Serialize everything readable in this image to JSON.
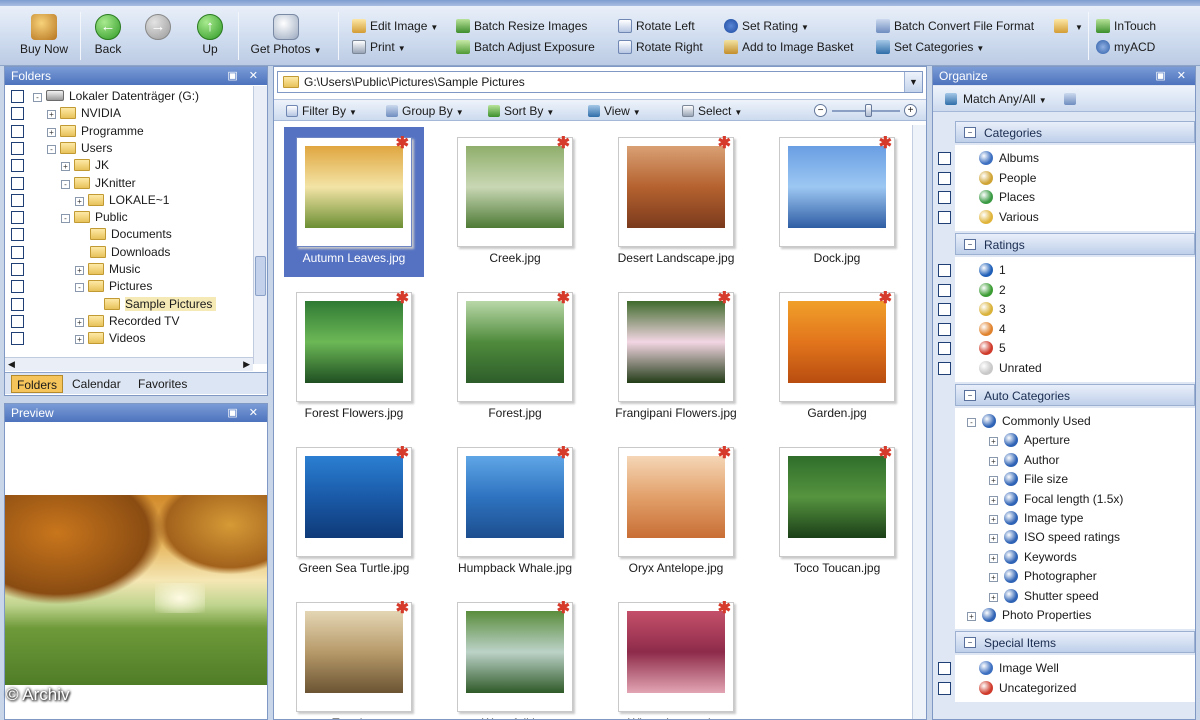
{
  "toolbar": {
    "buy_now": "Buy Now",
    "back": "Back",
    "up": "Up",
    "get_photos": "Get Photos",
    "edit_image": "Edit Image",
    "print": "Print",
    "batch_resize": "Batch Resize Images",
    "batch_exposure": "Batch Adjust Exposure",
    "rotate_left": "Rotate Left",
    "rotate_right": "Rotate Right",
    "set_rating": "Set Rating",
    "add_basket": "Add to Image Basket",
    "batch_convert": "Batch Convert File Format",
    "set_categories": "Set Categories",
    "intouch": "InTouch",
    "myacd": "myACD"
  },
  "folders": {
    "title": "Folders",
    "tree": [
      {
        "label": "Lokaler Datenträger (G:)",
        "depth": 0,
        "type": "drive",
        "expander": "-"
      },
      {
        "label": "NVIDIA",
        "depth": 1,
        "type": "folder",
        "expander": "+"
      },
      {
        "label": "Programme",
        "depth": 1,
        "type": "folder",
        "expander": "+"
      },
      {
        "label": "Users",
        "depth": 1,
        "type": "folder",
        "expander": "-"
      },
      {
        "label": "JK",
        "depth": 2,
        "type": "folder",
        "expander": "+"
      },
      {
        "label": "JKnitter",
        "depth": 2,
        "type": "folder",
        "expander": "-"
      },
      {
        "label": "LOKALE~1",
        "depth": 3,
        "type": "folder",
        "expander": "+"
      },
      {
        "label": "Public",
        "depth": 2,
        "type": "folder",
        "expander": "-"
      },
      {
        "label": "Documents",
        "depth": 3,
        "type": "folder",
        "expander": ""
      },
      {
        "label": "Downloads",
        "depth": 3,
        "type": "folder",
        "expander": ""
      },
      {
        "label": "Music",
        "depth": 3,
        "type": "folder",
        "expander": "+"
      },
      {
        "label": "Pictures",
        "depth": 3,
        "type": "folder",
        "expander": "-"
      },
      {
        "label": "Sample Pictures",
        "depth": 4,
        "type": "folder",
        "expander": "",
        "selected": true
      },
      {
        "label": "Recorded TV",
        "depth": 3,
        "type": "folder",
        "expander": "+"
      },
      {
        "label": "Videos",
        "depth": 3,
        "type": "folder",
        "expander": "+"
      }
    ],
    "tabs": [
      "Folders",
      "Calendar",
      "Favorites"
    ]
  },
  "preview": {
    "title": "Preview"
  },
  "watermark": "© Archiv",
  "browser": {
    "path": "G:\\Users\\Public\\Pictures\\Sample Pictures",
    "viewbar": {
      "filter_by": "Filter By",
      "group_by": "Group By",
      "sort_by": "Sort By",
      "view": "View",
      "select": "Select"
    },
    "zoom_level": 0.55,
    "files": [
      {
        "name": "Autumn Leaves.jpg",
        "selected": true,
        "colors": [
          "#e0a640",
          "#f3e4a6",
          "#6c8f33"
        ]
      },
      {
        "name": "Creek.jpg",
        "colors": [
          "#8fae6b",
          "#c9d7b4",
          "#4d7a35"
        ]
      },
      {
        "name": "Desert Landscape.jpg",
        "colors": [
          "#d9a074",
          "#b5622f",
          "#7b3a1d"
        ]
      },
      {
        "name": "Dock.jpg",
        "colors": [
          "#6a9ee3",
          "#9cc7f3",
          "#2f5da3"
        ]
      },
      {
        "name": "Forest Flowers.jpg",
        "colors": [
          "#2f7a34",
          "#6cb856",
          "#1f4f22"
        ]
      },
      {
        "name": "Forest.jpg",
        "colors": [
          "#b9d8a8",
          "#4f8b3c",
          "#2d5d2a"
        ]
      },
      {
        "name": "Frangipani Flowers.jpg",
        "colors": [
          "#3f6b2c",
          "#f3d6e3",
          "#233d18"
        ]
      },
      {
        "name": "Garden.jpg",
        "colors": [
          "#f0a02a",
          "#e2751c",
          "#b94d10"
        ]
      },
      {
        "name": "Green Sea Turtle.jpg",
        "colors": [
          "#2b7fd2",
          "#1a5aa8",
          "#0f3a78"
        ]
      },
      {
        "name": "Humpback Whale.jpg",
        "colors": [
          "#5fa6e6",
          "#2e73c0",
          "#1d4f8f"
        ]
      },
      {
        "name": "Oryx Antelope.jpg",
        "colors": [
          "#f5d6b6",
          "#e2a06a",
          "#c86e35"
        ]
      },
      {
        "name": "Toco Toucan.jpg",
        "colors": [
          "#2f6e2b",
          "#56943f",
          "#1b3f18"
        ]
      },
      {
        "name": "Tree.jpg",
        "colors": [
          "#e4d6b4",
          "#b79a6a",
          "#6b5433"
        ]
      },
      {
        "name": "Waterfall.jpg",
        "colors": [
          "#5a8d3c",
          "#bcd2c8",
          "#2f5a28"
        ]
      },
      {
        "name": "Winter Leaves.jpg",
        "colors": [
          "#c4506a",
          "#8e2b4a",
          "#e2a5b3"
        ]
      }
    ]
  },
  "organize": {
    "title": "Organize",
    "match": "Match Any/All",
    "categories": {
      "title": "Categories",
      "items": [
        {
          "label": "Albums",
          "icon": "albums-icon",
          "color": "#3c6fc0"
        },
        {
          "label": "People",
          "icon": "people-icon",
          "color": "#d0a434"
        },
        {
          "label": "Places",
          "icon": "places-icon",
          "color": "#3a9a44"
        },
        {
          "label": "Various",
          "icon": "various-icon",
          "color": "#e0b43a"
        }
      ]
    },
    "ratings": {
      "title": "Ratings",
      "items": [
        {
          "label": "1",
          "color": "#1f5fb8"
        },
        {
          "label": "2",
          "color": "#3b9c33"
        },
        {
          "label": "3",
          "color": "#d9b23a"
        },
        {
          "label": "4",
          "color": "#e0832e"
        },
        {
          "label": "5",
          "color": "#cf3a2a"
        },
        {
          "label": "Unrated",
          "color": "#c8c8c8"
        }
      ]
    },
    "auto_categories": {
      "title": "Auto Categories",
      "items": [
        {
          "label": "Commonly Used",
          "depth": 0,
          "expander": "-"
        },
        {
          "label": "Aperture",
          "depth": 1,
          "expander": "+"
        },
        {
          "label": "Author",
          "depth": 1,
          "expander": "+"
        },
        {
          "label": "File size",
          "depth": 1,
          "expander": "+"
        },
        {
          "label": "Focal length (1.5x)",
          "depth": 1,
          "expander": "+"
        },
        {
          "label": "Image type",
          "depth": 1,
          "expander": "+"
        },
        {
          "label": "ISO speed ratings",
          "depth": 1,
          "expander": "+"
        },
        {
          "label": "Keywords",
          "depth": 1,
          "expander": "+"
        },
        {
          "label": "Photographer",
          "depth": 1,
          "expander": "+"
        },
        {
          "label": "Shutter speed",
          "depth": 1,
          "expander": "+"
        },
        {
          "label": "Photo Properties",
          "depth": 0,
          "expander": "+"
        }
      ]
    },
    "special_items": {
      "title": "Special Items",
      "items": [
        {
          "label": "Image Well",
          "color": "#3c6fc0"
        },
        {
          "label": "Uncategorized",
          "color": "#cf3a2a"
        }
      ]
    }
  }
}
